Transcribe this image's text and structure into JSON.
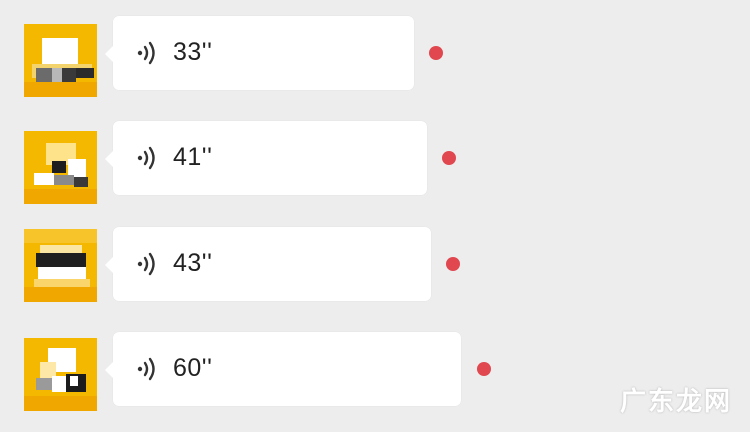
{
  "colors": {
    "background": "#ededed",
    "bubble": "#ffffff",
    "unread_dot": "#e0474f",
    "avatar_base": "#f5b800"
  },
  "messages": [
    {
      "duration": "33''",
      "icon": "voice-wave-icon",
      "unread": true
    },
    {
      "duration": "41''",
      "icon": "voice-wave-icon",
      "unread": true
    },
    {
      "duration": "43''",
      "icon": "voice-wave-icon",
      "unread": true
    },
    {
      "duration": "60''",
      "icon": "voice-wave-icon",
      "unread": true
    }
  ],
  "watermark": "广东龙网"
}
